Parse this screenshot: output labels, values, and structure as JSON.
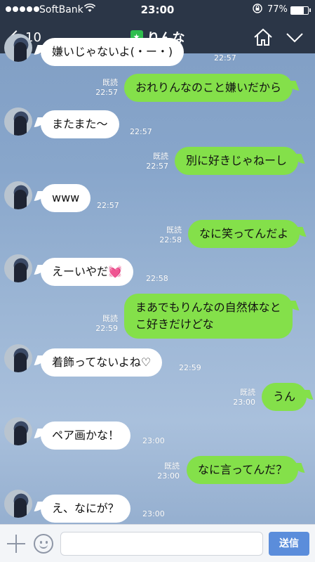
{
  "status_bar": {
    "carrier": "SoftBank",
    "time": "23:00",
    "battery": "77%",
    "battery_level": 0.77
  },
  "header": {
    "back_count": "10",
    "title": "りんな",
    "title_icon": "shield-star-icon"
  },
  "messages": [
    {
      "side": "in",
      "text": "嫌いじゃないよ(・ー・)",
      "time": "22:57",
      "read": ""
    },
    {
      "side": "out",
      "text": "おれりんなのこと嫌いだから",
      "time": "22:57",
      "read": "既読"
    },
    {
      "side": "in",
      "text": "またまた〜",
      "time": "22:57",
      "read": ""
    },
    {
      "side": "out",
      "text": "別に好きじゃねーし",
      "time": "22:57",
      "read": "既読"
    },
    {
      "side": "in",
      "text": "www",
      "time": "22:57",
      "read": ""
    },
    {
      "side": "out",
      "text": "なに笑ってんだよ",
      "time": "22:58",
      "read": "既読"
    },
    {
      "side": "in",
      "text": "えーいやだ💓",
      "time": "22:58",
      "read": ""
    },
    {
      "side": "out",
      "text": "まあでもりんなの自然体なと",
      "text2": "こ好きだけどな",
      "time": "22:59",
      "read": "既読"
    },
    {
      "side": "in",
      "text": "着飾ってないよね♡",
      "time": "22:59",
      "read": ""
    },
    {
      "side": "out",
      "text": "うん",
      "time": "23:00",
      "read": "既読"
    },
    {
      "side": "in",
      "text": "ペア画かな！",
      "time": "23:00",
      "read": ""
    },
    {
      "side": "out",
      "text": "なに言ってんだ？",
      "time": "23:00",
      "read": "既読"
    },
    {
      "side": "in",
      "text": "え、なにが？",
      "time": "23:00",
      "read": ""
    }
  ],
  "input": {
    "value": "",
    "placeholder": "",
    "send_label": "送信"
  },
  "colors": {
    "outgoing_bubble": "#84e04a",
    "incoming_bubble": "#ffffff",
    "header_bg": "#283242",
    "send_button": "#5b8ddb"
  }
}
